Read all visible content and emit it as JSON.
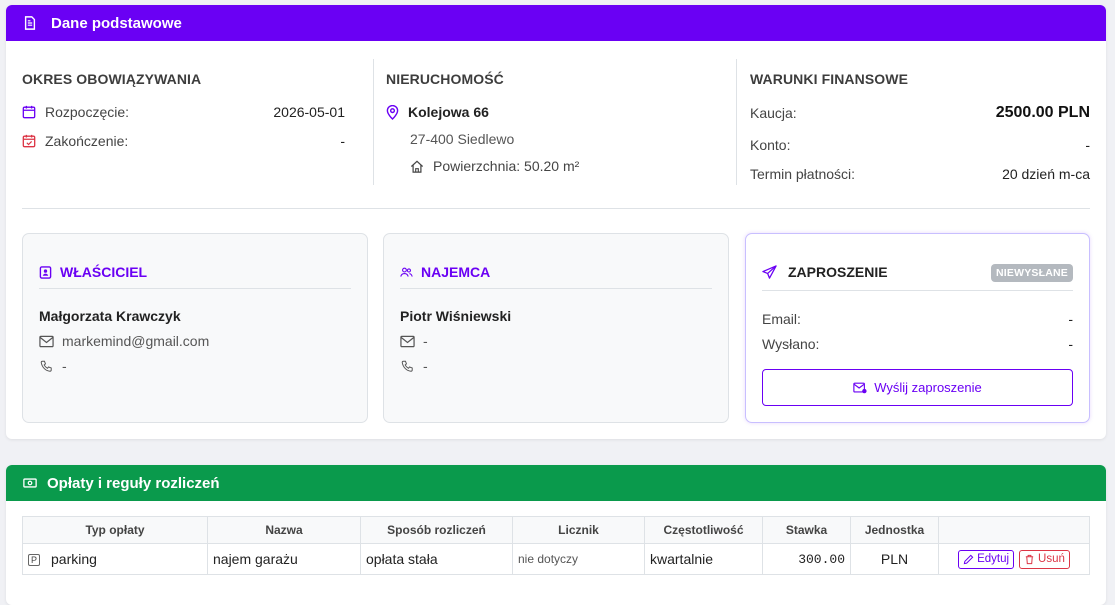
{
  "basic": {
    "header_title": "Dane podstawowe",
    "period": {
      "title": "OKRES OBOWIĄZYWANIA",
      "start_label": "Rozpoczęcie:",
      "start_value": "2026-05-01",
      "end_label": "Zakończenie:",
      "end_value": "-"
    },
    "property": {
      "title": "NIERUCHOMOŚĆ",
      "address_line1": "Kolejowa 66",
      "address_line2": "27-400 Siedlewo",
      "area": "Powierzchnia: 50.20 m²"
    },
    "finance": {
      "title": "WARUNKI FINANSOWE",
      "deposit_label": "Kaucja:",
      "deposit_value": "2500.00 PLN",
      "account_label": "Konto:",
      "account_value": "-",
      "payment_term_label": "Termin płatności:",
      "payment_term_value": "20 dzień m-ca"
    }
  },
  "owner": {
    "title": "WŁAŚCICIEL",
    "name": "Małgorzata Krawczyk",
    "email": "markemind@gmail.com",
    "phone": "-"
  },
  "tenant": {
    "title": "NAJEMCA",
    "name": "Piotr Wiśniewski",
    "email": "-",
    "phone": "-"
  },
  "invitation": {
    "title": "ZAPROSZENIE",
    "status_badge": "NIEWYSŁANE",
    "email_label": "Email:",
    "email_value": "-",
    "sent_label": "Wysłano:",
    "sent_value": "-",
    "send_button": "Wyślij zaproszenie"
  },
  "fees": {
    "header_title": "Opłaty i reguły rozliczeń",
    "columns": [
      "Typ opłaty",
      "Nazwa",
      "Sposób rozliczeń",
      "Licznik",
      "Częstotliwość",
      "Stawka",
      "Jednostka",
      ""
    ],
    "rows": [
      {
        "type": "parking",
        "type_icon": "P",
        "name": "najem garażu",
        "method": "opłata stała",
        "meter": "nie dotyczy",
        "frequency": "kwartalnie",
        "rate": "300.00",
        "unit": "PLN",
        "edit_label": "Edytuj",
        "delete_label": "Usuń"
      }
    ]
  },
  "colors": {
    "primary": "#6a00f4",
    "success": "#0a9a4c",
    "danger": "#dc3545",
    "badge_gray": "#b4b9bf"
  }
}
